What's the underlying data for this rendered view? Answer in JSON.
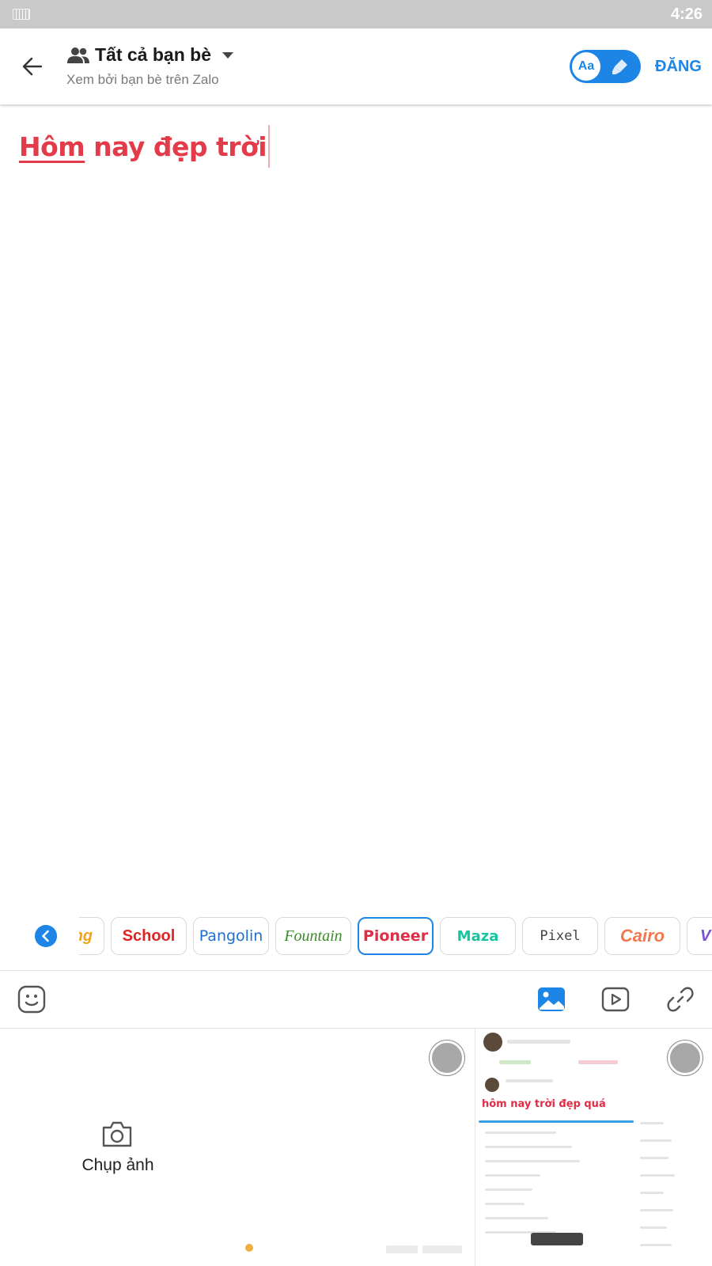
{
  "status_bar": {
    "time": "4:26",
    "keyboard_icon": "keyboard-icon"
  },
  "header": {
    "audience_title": "Tất cả bạn bè",
    "audience_subtitle": "Xem bởi bạn bè trên Zalo",
    "toggle_label": "Aa",
    "post_button": "ĐĂNG",
    "accent": "#1d85e6"
  },
  "editor": {
    "text_first": "Hôm",
    "text_rest": " nay đẹp trời",
    "text_color": "#e33b4a"
  },
  "font_picker": {
    "fonts": [
      {
        "label": "ng",
        "color": "#f0a21a"
      },
      {
        "label": "School",
        "color": "#e02424"
      },
      {
        "label": "Pangolin",
        "color": "#1d6fd0"
      },
      {
        "label": "Fountain",
        "color": "#3a8a2a"
      },
      {
        "label": "Pioneer",
        "color": "#e02c44",
        "selected": true
      },
      {
        "label": "Maza",
        "color": "#14c6a0"
      },
      {
        "label": "Pixel",
        "color": "#444444"
      },
      {
        "label": "Cairo",
        "color": "#f07850"
      },
      {
        "label": "V",
        "color": "#7a4fd0"
      }
    ]
  },
  "toolbar": {
    "icons": [
      "emoji-icon",
      "image-icon",
      "video-icon",
      "link-icon"
    ]
  },
  "gallery": {
    "camera_label": "Chụp ảnh",
    "thumb2_heading": "hôm nay trời đẹp quá"
  }
}
